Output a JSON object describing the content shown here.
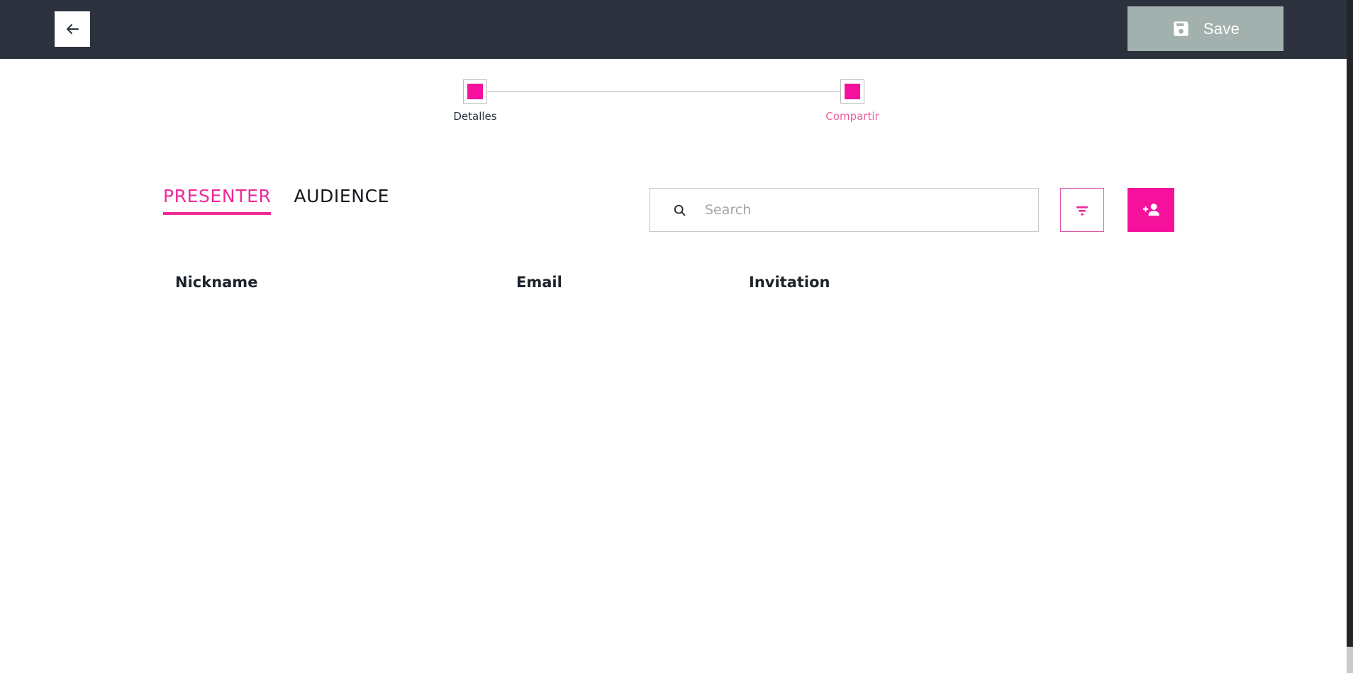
{
  "topbar": {
    "back_icon": "arrow-left-icon",
    "save": {
      "label": "Save",
      "icon": "save-floppy-icon",
      "enabled": false,
      "background_color": "#a2b0ae"
    },
    "background_color": "#2b323e"
  },
  "stepper": {
    "steps": [
      {
        "label": "Detalles",
        "state": "completed"
      },
      {
        "label": "Compartir",
        "state": "active"
      }
    ],
    "marker_color": "#f5119b",
    "active_label_color": "#ef5fa0"
  },
  "tabs": [
    {
      "label": "PRESENTER",
      "active": true
    },
    {
      "label": "AUDIENCE",
      "active": false
    }
  ],
  "search": {
    "placeholder": "Search",
    "value": "",
    "icon": "search-icon"
  },
  "actions": {
    "filter": {
      "icon": "filter-icon",
      "label": ""
    },
    "add_person": {
      "icon": "person-add-icon",
      "label": ""
    }
  },
  "table": {
    "columns": [
      "Nickname",
      "Email",
      "Invitation"
    ],
    "rows": []
  },
  "theme": {
    "accent": "#f5119b",
    "accent_tab": "#ee2a9b",
    "dark": "#2b323e",
    "border": "#c9c9c9"
  }
}
